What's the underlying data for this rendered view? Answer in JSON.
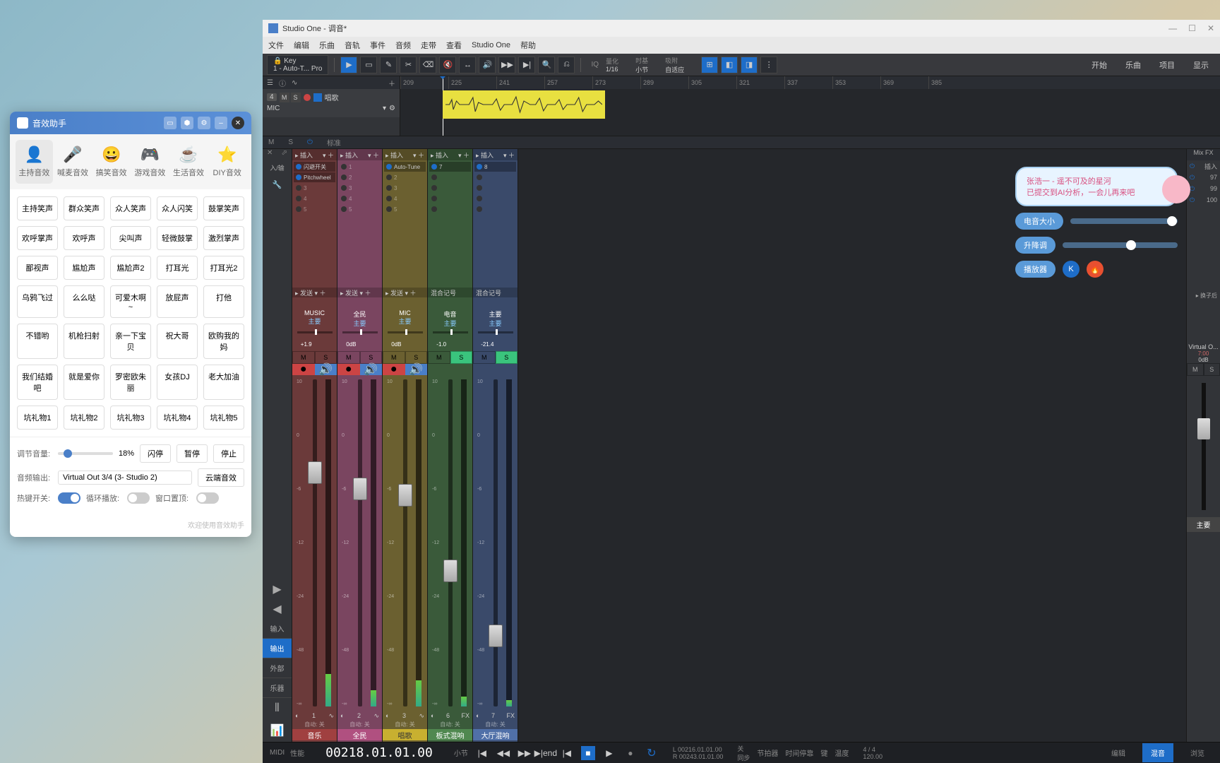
{
  "sfx": {
    "title": "音效助手",
    "tabs": [
      {
        "icon": "👤",
        "label": "主持音效",
        "active": true
      },
      {
        "icon": "🎤",
        "label": "喊麦音效"
      },
      {
        "icon": "😀",
        "label": "搞笑音效"
      },
      {
        "icon": "🎮",
        "label": "游戏音效"
      },
      {
        "icon": "☕",
        "label": "生活音效"
      },
      {
        "icon": "⭐",
        "label": "DIY音效"
      }
    ],
    "buttons": [
      "主持笑声",
      "群众笑声",
      "众人笑声",
      "众人闪笑",
      "鼓掌笑声",
      "欢呼掌声",
      "欢呼声",
      "尖叫声",
      "轻微鼓掌",
      "激烈掌声",
      "鄙视声",
      "尴尬声",
      "尴尬声2",
      "打耳光",
      "打耳光2",
      "乌鸦飞过",
      "么么哒",
      "可爱木啊~",
      "放屁声",
      "打他",
      "不错哟",
      "机枪扫射",
      "亲一下宝贝",
      "祝大哥",
      "欧购我的妈",
      "我们结婚吧",
      "就是爱你",
      "罗密欧朱丽",
      "女孩DJ",
      "老大加油",
      "坑礼物1",
      "坑礼物2",
      "坑礼物3",
      "坑礼物4",
      "坑礼物5"
    ],
    "volume_label": "调节音量:",
    "volume_pct": "18%",
    "flash_btn": "闪停",
    "pause_btn": "暂停",
    "stop_btn": "停止",
    "output_label": "音频输出:",
    "output_value": "Virtual Out 3/4 (3- Studio 2)",
    "cloud_btn": "云端音效",
    "hotkey_label": "热键开关:",
    "loop_label": "循环播放:",
    "ontop_label": "窗口置顶:",
    "footer": "欢迎使用音效助手"
  },
  "studio": {
    "title": "Studio One - 调音*",
    "menu": [
      "文件",
      "编辑",
      "乐曲",
      "音轨",
      "事件",
      "音频",
      "走带",
      "查看",
      "Studio One",
      "帮助"
    ],
    "key_label": "Key",
    "key_sub": "1 - Auto-T... Pro",
    "quantize": {
      "label": "量化",
      "val": "1/16"
    },
    "timebase": {
      "label": "时基",
      "val": "小节"
    },
    "snap": {
      "label": "吸附",
      "val": "自适应"
    },
    "toolbar_right": [
      "开始",
      "乐曲",
      "项目",
      "显示"
    ],
    "ruler_marks": [
      209,
      225,
      241,
      257,
      273,
      289,
      305,
      321,
      337,
      353,
      369,
      385
    ],
    "track": {
      "num": "4",
      "name": "唱歌",
      "input": "MIC"
    },
    "mixer_bar": {
      "m": "M",
      "s": "S",
      "std": "标准"
    },
    "mixer_left": [
      "输入",
      "输出",
      "外部",
      "乐器"
    ],
    "mixer_left_top": "入/输",
    "insert_label": "插入",
    "send_label": "发送",
    "bus_label": "混合记号",
    "main_label": "主要",
    "auto_label": "自动: 关",
    "channels": [
      {
        "cls": "ch-red",
        "name": "MUSIC",
        "gain": "+1.9",
        "cv": "<C>",
        "ms": [
          "M",
          "S"
        ],
        "fader": 25,
        "meter": 10,
        "num": "1",
        "fx": "",
        "label": "音乐",
        "inserts": [
          "闪避开关",
          "Pitchwheel"
        ]
      },
      {
        "cls": "ch-pink",
        "name": "全民",
        "gain": "0dB",
        "cv": "<C>",
        "ms": [
          "M",
          "S"
        ],
        "fader": 30,
        "meter": 5,
        "num": "2",
        "fx": "",
        "label": "全民",
        "inserts": []
      },
      {
        "cls": "ch-yellow",
        "name": "MIC",
        "gain": "0dB",
        "cv": "<C>",
        "ms": [
          "M",
          "S"
        ],
        "fader": 32,
        "meter": 8,
        "num": "3",
        "fx": "",
        "label": "唱歌",
        "inserts": [
          "Auto-Tune"
        ]
      },
      {
        "cls": "ch-green",
        "name": "电音",
        "gain": "-1.0",
        "cv": "<C>",
        "ms": [
          "M",
          "S"
        ],
        "s_on": true,
        "fader": 55,
        "meter": 3,
        "num": "6",
        "fx": "FX",
        "label": "板式混响",
        "inserts": [
          "7"
        ],
        "bus": true
      },
      {
        "cls": "ch-blue",
        "name": "主要",
        "gain": "-21.4",
        "cv": "<C>",
        "ms": [
          "M",
          "S"
        ],
        "s_on": true,
        "fader": 75,
        "meter": 2,
        "num": "7",
        "fx": "FX",
        "label": "大厅混响",
        "inserts": [
          "8"
        ],
        "bus": true
      }
    ],
    "mixfx": {
      "header": "Mix FX",
      "items": [
        [
          "插入",
          ""
        ],
        [
          "97",
          ""
        ],
        [
          "99",
          ""
        ],
        [
          "100",
          ""
        ]
      ],
      "swap": "换子后",
      "vo": "Virtual O...",
      "vo_vals": [
        "7:00",
        "0dB"
      ],
      "ms": [
        "M",
        "S"
      ],
      "main": "主要"
    },
    "bubble": {
      "line1": "张浩一 - 遥不可及的星河",
      "line2": "已提交到AI分析，一会儿再来吧"
    },
    "overlay": {
      "btn1": "电音大小",
      "btn2": "升降调",
      "btn3": "播放器",
      "s1": 90,
      "s2": 55
    },
    "transport": {
      "midi": "MIDI",
      "perf": "性能",
      "main_time": "00218.01.01.00",
      "bars": "小节",
      "loc1": "00216.01.01.00",
      "loc2": "00243.01.01.00",
      "locL": "L",
      "locR": "R",
      "off": "关",
      "sync": "同步",
      "beat": "节拍器",
      "delay": "时间停靠",
      "key": "键",
      "tempo_lbl": "温度",
      "sig": "4 / 4",
      "tempo": "120.00",
      "tabs": [
        "编辑",
        "混音",
        "浏览"
      ]
    }
  }
}
